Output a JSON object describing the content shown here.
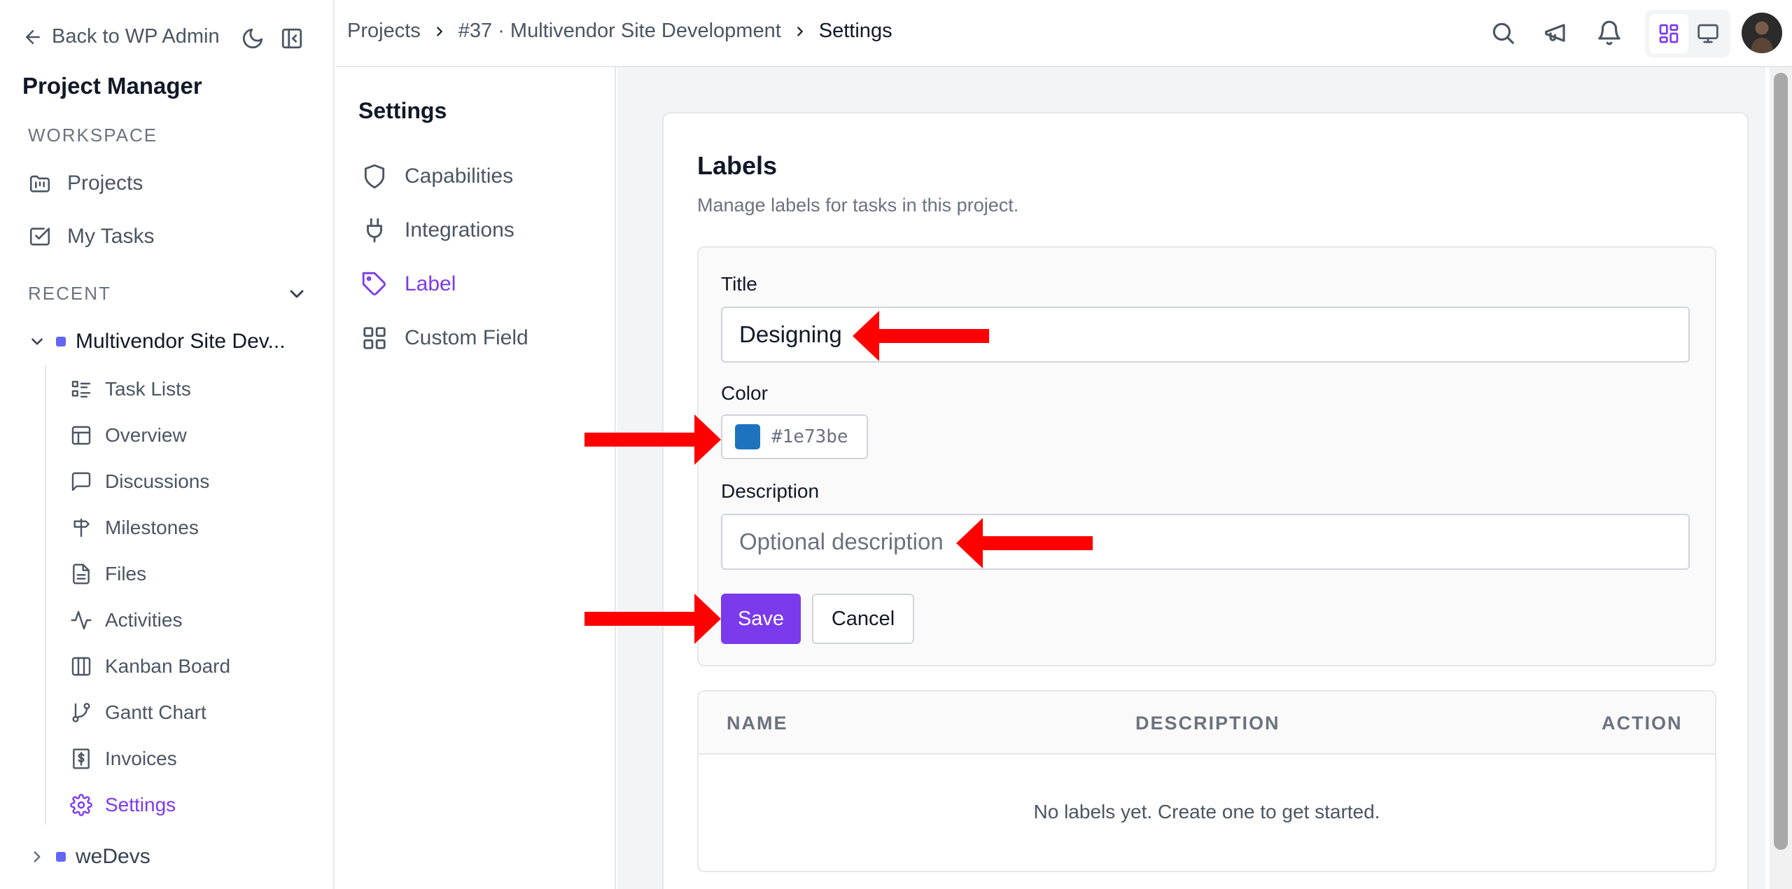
{
  "sidebar": {
    "back_label": "Back to WP Admin",
    "app_title": "Project Manager",
    "workspace_label": "WORKSPACE",
    "workspace_items": [
      "Projects",
      "My Tasks"
    ],
    "recent_label": "RECENT",
    "projects": [
      {
        "name": "Multivendor Site Dev...",
        "expanded": true,
        "sub_items": [
          "Task Lists",
          "Overview",
          "Discussions",
          "Milestones",
          "Files",
          "Activities",
          "Kanban Board",
          "Gantt Chart",
          "Invoices",
          "Settings"
        ],
        "active_item": "Settings"
      },
      {
        "name": "weDevs",
        "expanded": false
      }
    ]
  },
  "header": {
    "breadcrumb": [
      "Projects",
      "#37 · Multivendor Site Development",
      "Settings"
    ]
  },
  "settings_nav": {
    "title": "Settings",
    "items": [
      "Capabilities",
      "Integrations",
      "Label",
      "Custom Field"
    ],
    "active_item": "Label"
  },
  "labels_panel": {
    "title": "Labels",
    "subtitle": "Manage labels for tasks in this project.",
    "form": {
      "title_label": "Title",
      "title_value": "Designing",
      "color_label": "Color",
      "color_value": "#1e73be",
      "description_label": "Description",
      "description_value": "",
      "description_placeholder": "Optional description",
      "save_label": "Save",
      "cancel_label": "Cancel"
    },
    "table": {
      "columns": [
        "NAME",
        "DESCRIPTION",
        "ACTION"
      ],
      "empty_message": "No labels yet. Create one to get started."
    }
  },
  "colors": {
    "accent": "#7c3aed",
    "annotation_arrow": "#ff0000",
    "project_dot": "#6366f1"
  }
}
